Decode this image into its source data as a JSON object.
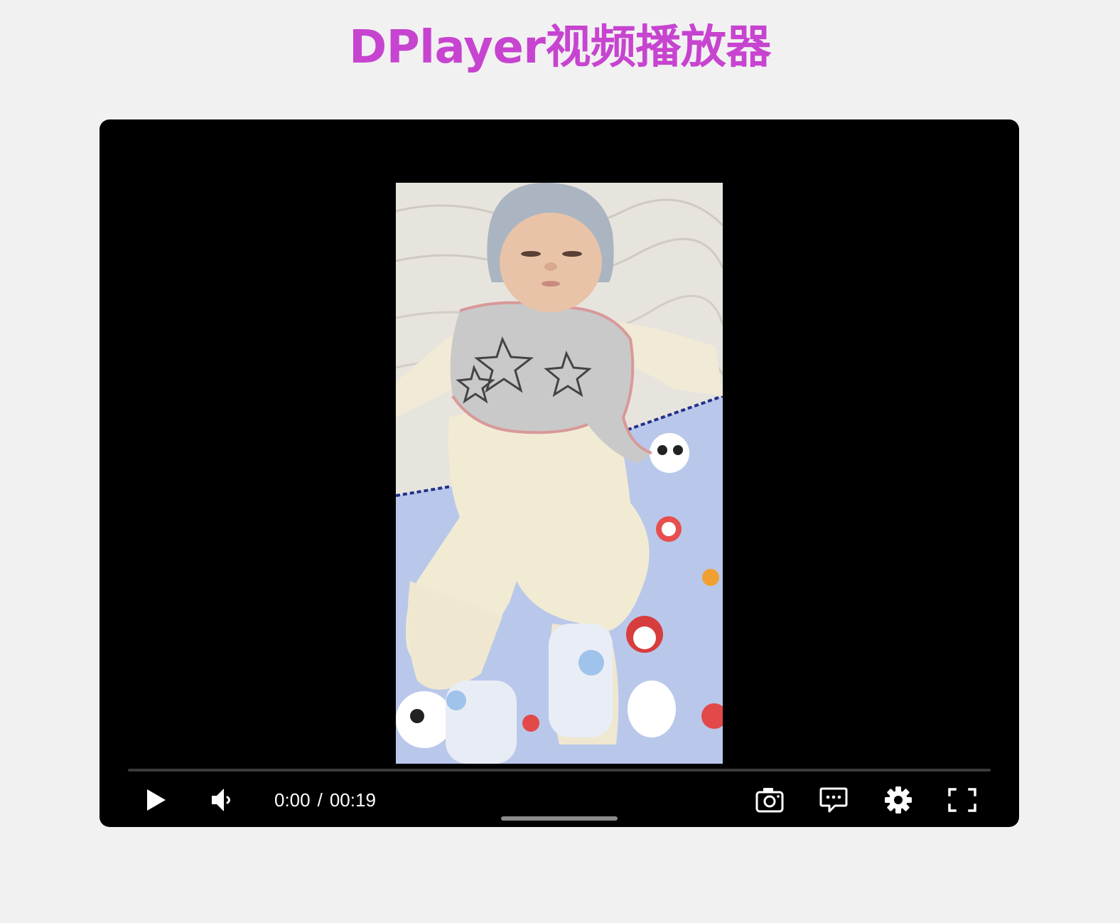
{
  "page": {
    "title": "DPlayer视频播放器",
    "title_color": "#c744d0"
  },
  "player": {
    "background": "#000000",
    "progress_track_color": "#3a3a3a",
    "progress_played_color": "#b7daff",
    "progress_fraction": 0,
    "current_time": "0:00",
    "separator": "/",
    "duration": "00:19",
    "video_description_icon": "video-frame",
    "icons": {
      "play": "play-icon",
      "volume": "volume-icon",
      "screenshot": "camera-icon",
      "danmaku": "comment-icon",
      "settings": "gear-icon",
      "fullscreen": "fullscreen-icon"
    }
  }
}
